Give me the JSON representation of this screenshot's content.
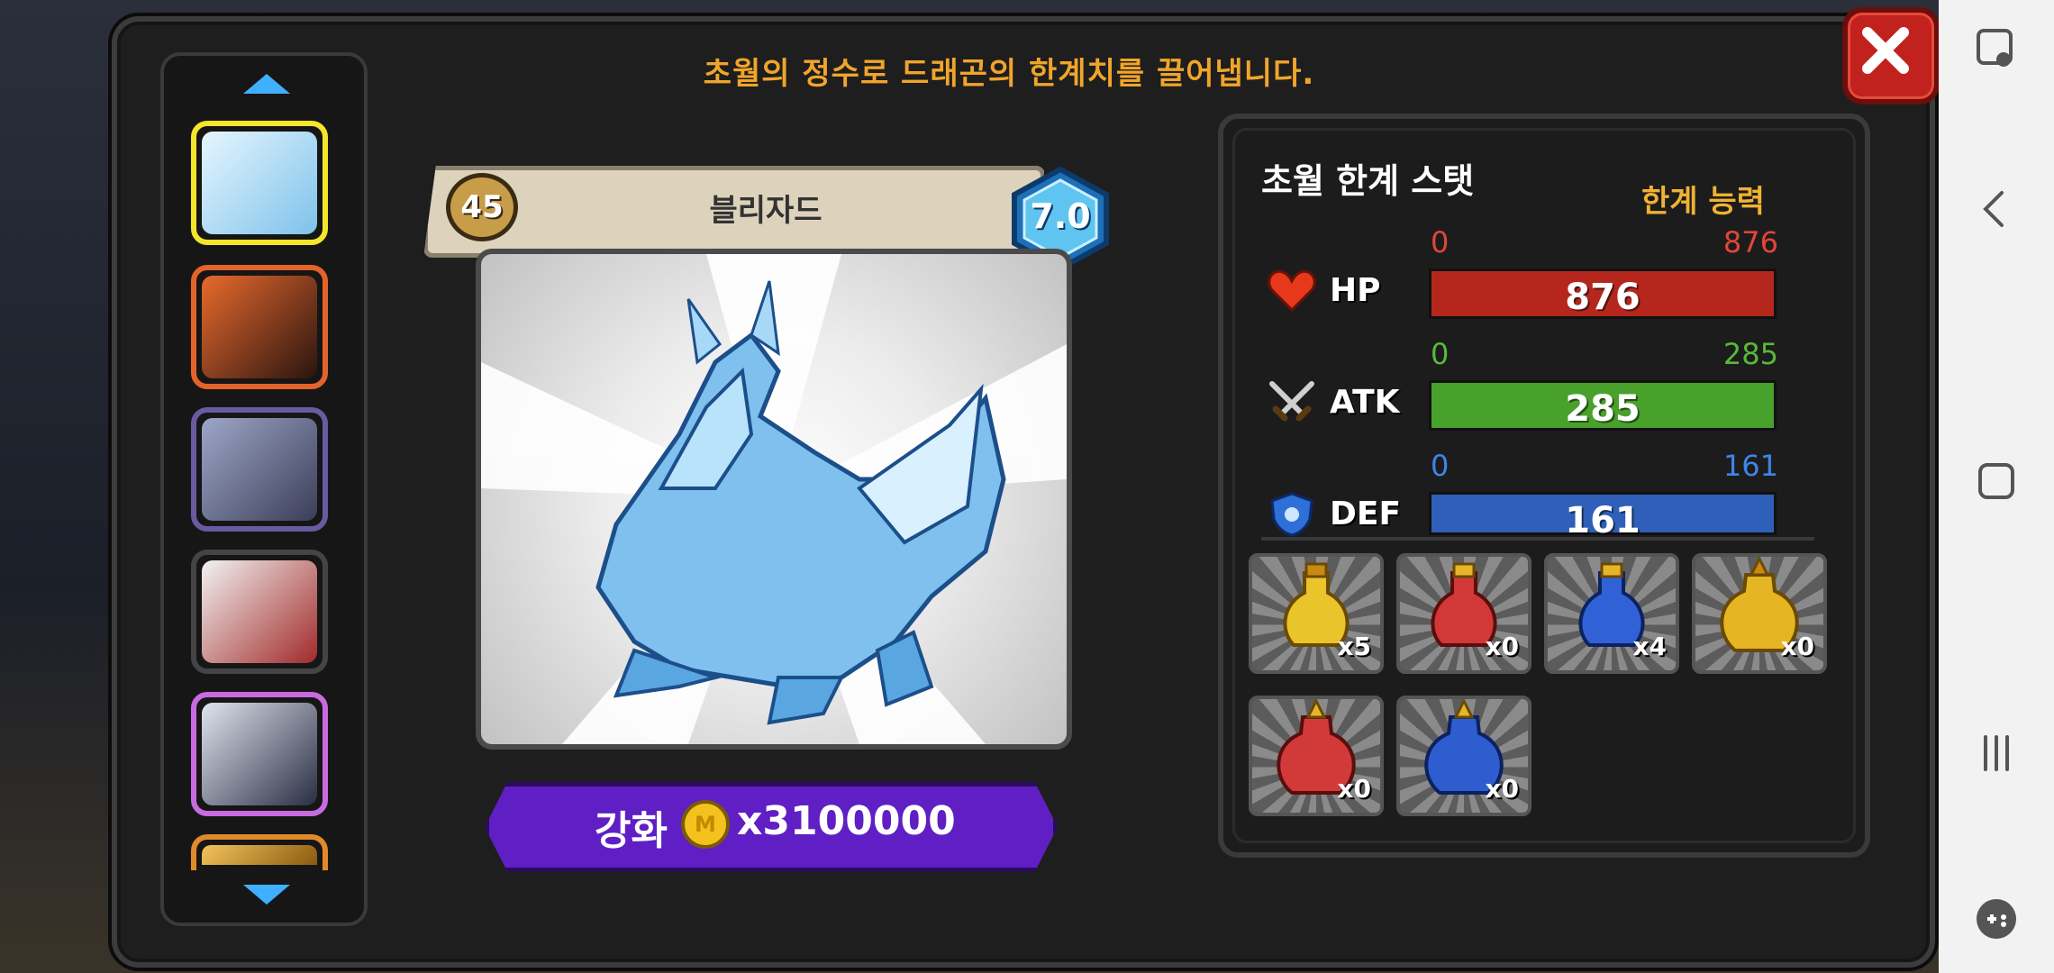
{
  "header": {
    "title": "초월의 정수로 드래곤의 한계치를 끌어냅니다."
  },
  "close": {
    "icon": "close-icon"
  },
  "dragon": {
    "level": "45",
    "name": "블리자드",
    "grade": "7.0"
  },
  "enhance": {
    "label": "강화",
    "coin_symbol": "M",
    "cost": "x3100000"
  },
  "stats": {
    "title": "초월 한계 스탯",
    "limit_label": "한계 능력",
    "rows": [
      {
        "label": "HP",
        "min": "0",
        "max": "876",
        "value": "876",
        "fill": 1.0,
        "color": "#b5271d",
        "range_color": "#e0463a"
      },
      {
        "label": "ATK",
        "min": "0",
        "max": "285",
        "value": "285",
        "fill": 1.0,
        "color": "#48a12a",
        "range_color": "#58b838"
      },
      {
        "label": "DEF",
        "min": "0",
        "max": "161",
        "value": "161",
        "fill": 1.0,
        "color": "#2f5fb8",
        "range_color": "#3f84e8"
      }
    ]
  },
  "items": [
    {
      "count": "x5",
      "color": "#e9c42a"
    },
    {
      "count": "x0",
      "color": "#d33838"
    },
    {
      "count": "x4",
      "color": "#3161d6"
    },
    {
      "count": "x0",
      "color": "#e6b523"
    },
    {
      "count": "x0",
      "color": "#d23a3a"
    },
    {
      "count": "x0",
      "color": "#2e5dd0"
    }
  ],
  "dragon_list": [
    {
      "name": "ice-dragon",
      "border": "#f5e52b",
      "bg": "#bfe3f7"
    },
    {
      "name": "fire-dragon",
      "border": "#e3632a",
      "bg": "#5a2618"
    },
    {
      "name": "skull-dragon",
      "border": "#6a5aa0",
      "bg": "#5a5f7e"
    },
    {
      "name": "red-white-dragon",
      "border": "#3a3a3a",
      "bg": "#9b2b2b"
    },
    {
      "name": "dark-dragon",
      "border": "#c96be0",
      "bg": "#5c6a8a"
    },
    {
      "name": "gold-dragon",
      "border": "#e08a2a",
      "bg": "#d9a02b"
    }
  ]
}
